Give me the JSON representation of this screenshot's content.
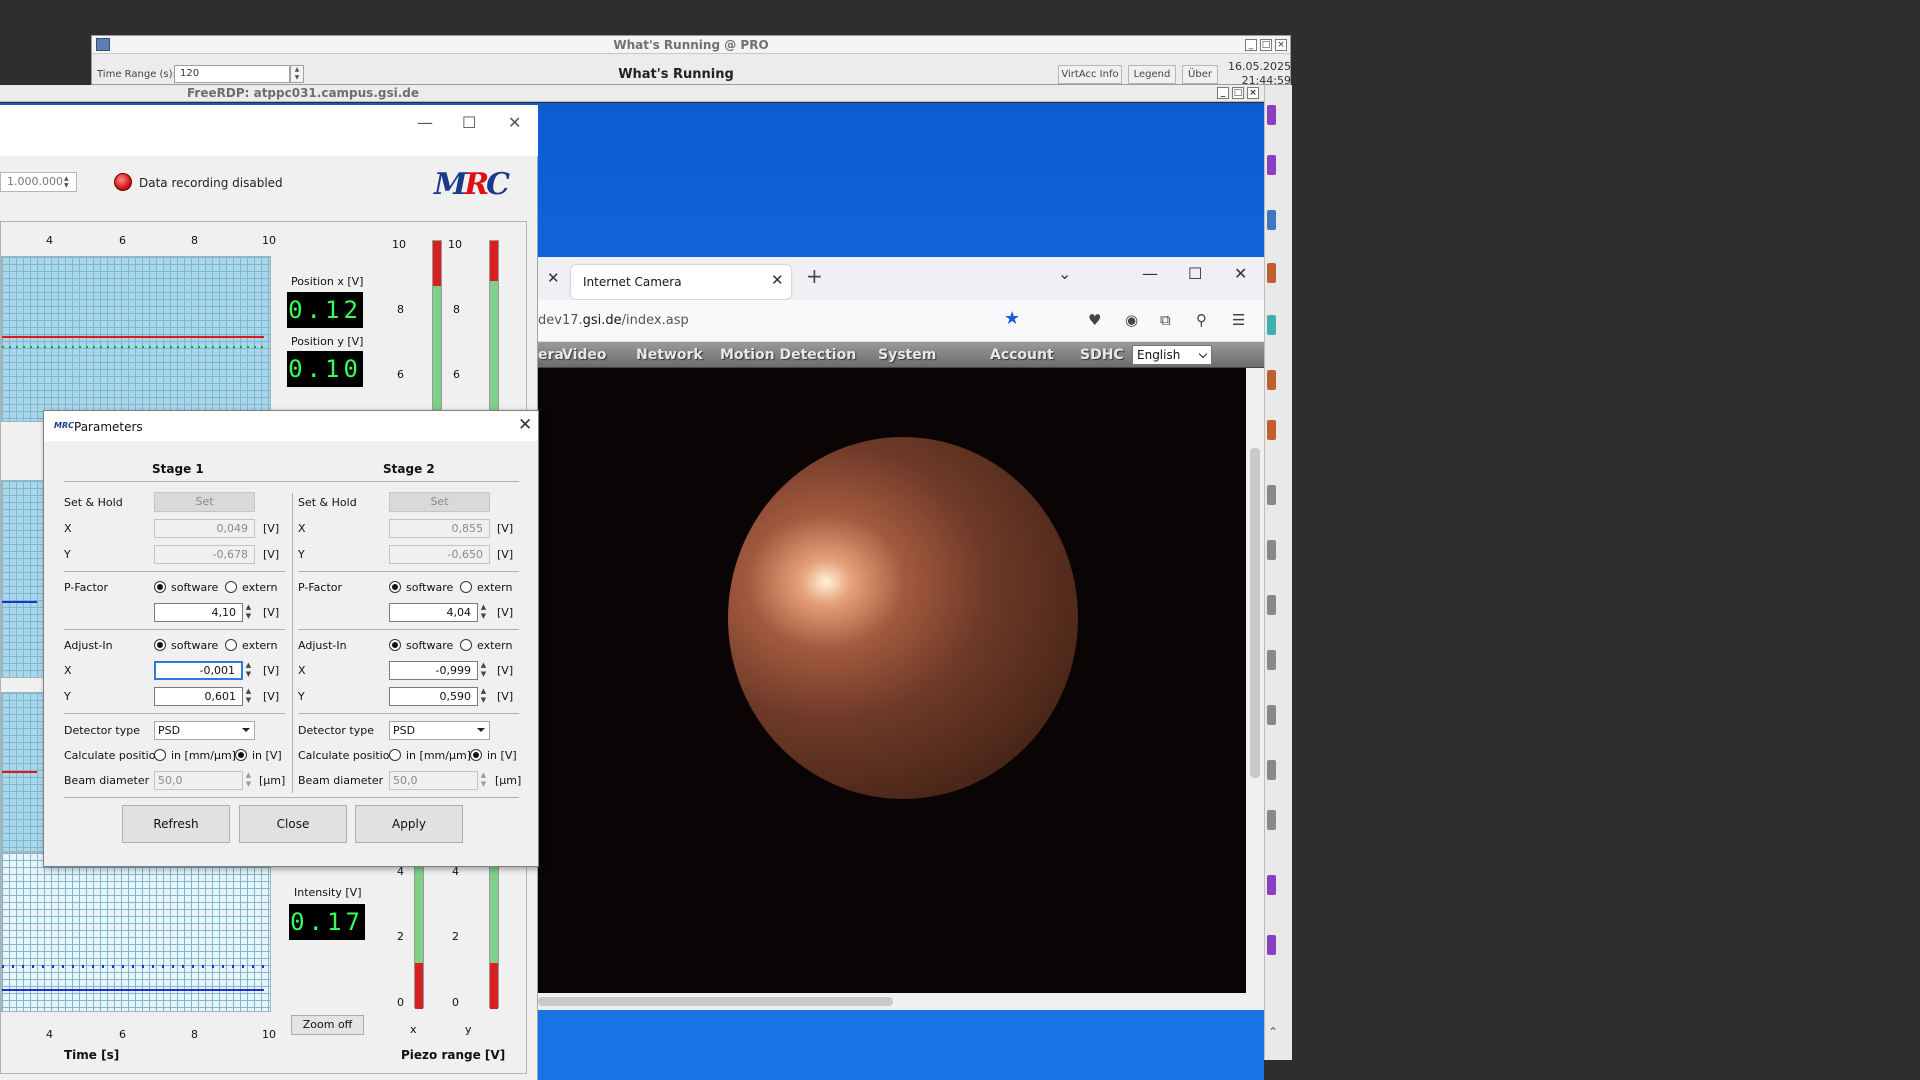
{
  "whats_running": {
    "window_title": "What's Running @ PRO",
    "time_range_label": "Time Range (s):",
    "time_range_value": "120",
    "heading": "What's Running",
    "buttons": [
      "VirtAcc Info",
      "Legend",
      "Über"
    ],
    "date": "16.05.2025",
    "time": "21:44:59"
  },
  "freerdp": {
    "title": "FreeRDP: atppc031.campus.gsi.de"
  },
  "mrc": {
    "spin_value": "1.000.000",
    "recording_status": "Data recording disabled",
    "logo": {
      "m": "M",
      "r": "R",
      "c": "C"
    },
    "time_ticks": [
      "4",
      "6",
      "8",
      "10"
    ],
    "time_axis_label": "Time [s]",
    "position_x_label": "Position x [V]",
    "position_x_value": "0.12",
    "position_y_label": "Position y [V]",
    "position_y_value": "0.10",
    "intensity_label": "Intensity [V]",
    "intensity_value": "0.17",
    "zoom_off": "Zoom off",
    "piezo_ticks_top": [
      "10",
      "8",
      "6"
    ],
    "piezo_ticks_second": [
      "10",
      "8",
      "6"
    ],
    "piezo_ticks_bottom": [
      "4",
      "2",
      "0"
    ],
    "piezo_ticks_bottom_second": [
      "4",
      "2",
      "0"
    ],
    "piezo_x": "x",
    "piezo_y": "y",
    "piezo_label": "Piezo range [V]",
    "piezo_levels": {
      "x_red": 0.88,
      "y_red": 0.88
    }
  },
  "parameters": {
    "title": "Parameters",
    "icon_text": "MRC",
    "stages": [
      {
        "heading": "Stage 1",
        "set_hold_label": "Set & Hold",
        "set_button": "Set",
        "x_label": "X",
        "x_value": "0,049",
        "y_label": "Y",
        "y_value": "-0,678",
        "pfactor_label": "P-Factor",
        "pfactor_value": "4,10",
        "adjust_label": "Adjust-In",
        "adj_x": "-0,001",
        "adj_y": "0,601",
        "detector_label": "Detector type",
        "detector_value": "PSD",
        "calc_label": "Calculate position",
        "calc_mm": "in [mm/µm]",
        "calc_v": "in [V]",
        "beam_label": "Beam diameter",
        "beam_value": "50,0",
        "beam_unit": "[µm]"
      },
      {
        "heading": "Stage 2",
        "set_hold_label": "Set & Hold",
        "set_button": "Set",
        "x_label": "X",
        "x_value": "0,855",
        "y_label": "Y",
        "y_value": "-0,650",
        "pfactor_label": "P-Factor",
        "pfactor_value": "4,04",
        "adjust_label": "Adjust-In",
        "adj_x": "-0,999",
        "adj_y": "0,590",
        "detector_label": "Detector type",
        "detector_value": "PSD",
        "calc_label": "Calculate position",
        "calc_mm": "in [mm/µm]",
        "calc_v": "in [V]",
        "beam_label": "Beam diameter",
        "beam_value": "50,0",
        "beam_unit": "[µm]"
      }
    ],
    "unit_v": "[V]",
    "software": "software",
    "extern": "extern",
    "buttons": {
      "refresh": "Refresh",
      "close": "Close",
      "apply": "Apply"
    }
  },
  "browser": {
    "tab_title": "Internet Camera",
    "url_prefix": "dev17.",
    "url_host": "gsi.de",
    "url_path": "/index.asp",
    "menu": [
      "era",
      "Video",
      "Network",
      "Motion Detection",
      "System",
      "Account",
      "SDHC"
    ],
    "language": "English"
  }
}
